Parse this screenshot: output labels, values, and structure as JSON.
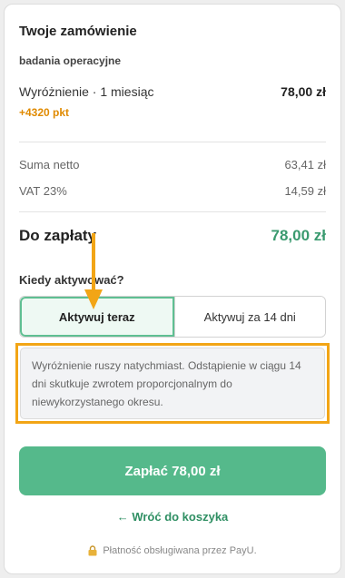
{
  "order": {
    "title": "Twoje zamówienie",
    "subtitle": "badania operacyjne",
    "item_name": "Wyróżnienie · 1 miesiąc",
    "item_price": "78,00 zł",
    "points": "+4320 pkt"
  },
  "summary": {
    "net_label": "Suma netto",
    "net_value": "63,41 zł",
    "vat_label": "VAT 23%",
    "vat_value": "14,59 zł",
    "total_label": "Do zapłaty",
    "total_value": "78,00 zł"
  },
  "activation": {
    "question": "Kiedy aktywować?",
    "options": [
      "Aktywuj teraz",
      "Aktywuj za 14 dni"
    ],
    "selected": "Aktywuj teraz",
    "info": "Wyróżnienie ruszy natychmiast. Odstąpienie w ciągu 14 dni skutkuje zwrotem proporcjonalnym do niewykorzystanego okresu."
  },
  "actions": {
    "pay_label": "Zapłać 78,00 zł",
    "back_label": "← Wróć do koszyka"
  },
  "footer": {
    "icon": "lock-icon",
    "text": "Płatność obsługiwana przez PayU."
  },
  "colors": {
    "accent": "#55b98b",
    "total": "#3a9a6f",
    "points": "#e08a00",
    "highlight": "#f2a516"
  }
}
